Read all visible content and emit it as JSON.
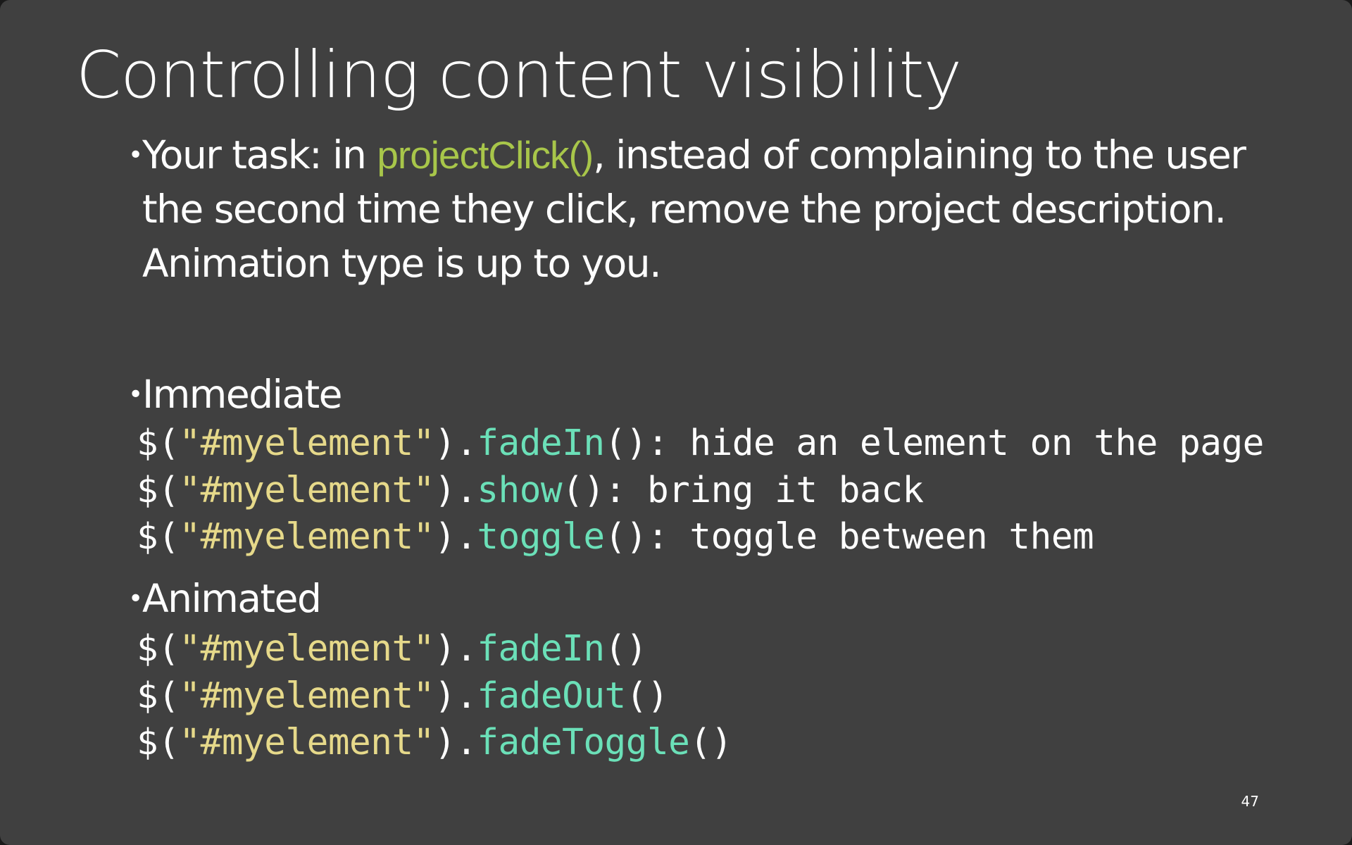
{
  "slide": {
    "title": "Controlling content visibility",
    "task_bullet": {
      "line1_pre": "Your task: in ",
      "line1_code": "projectClick()",
      "line1_post": ", instead of complaining to the user",
      "line2": "the second time they click, remove the project description.",
      "line3": "Animation type is up to you."
    },
    "immediate_heading": "Immediate",
    "immediate_lines": [
      {
        "prefix": "$(",
        "selector": "\"#myelement\"",
        "dot": ").",
        "method": "fadeIn",
        "suffix": "(): hide an element on the page"
      },
      {
        "prefix": "$(",
        "selector": "\"#myelement\"",
        "dot": ").",
        "method": "show",
        "suffix": "(): bring it back"
      },
      {
        "prefix": "$(",
        "selector": "\"#myelement\"",
        "dot": ").",
        "method": "toggle",
        "suffix": "(): toggle between them"
      }
    ],
    "animated_heading": "Animated",
    "animated_lines": [
      {
        "prefix": "$(",
        "selector": "\"#myelement\"",
        "dot": ").",
        "method": "fadeIn",
        "suffix": "()"
      },
      {
        "prefix": "$(",
        "selector": "\"#myelement\"",
        "dot": ").",
        "method": "fadeOut",
        "suffix": "()"
      },
      {
        "prefix": "$(",
        "selector": "\"#myelement\"",
        "dot": ").",
        "method": "fadeToggle",
        "suffix": "()"
      }
    ],
    "page_number": "47"
  },
  "colors": {
    "background": "#404040",
    "text": "#ffffff",
    "inline_code": "#a8c64a",
    "string": "#e6d98a",
    "method": "#6be0b8"
  }
}
